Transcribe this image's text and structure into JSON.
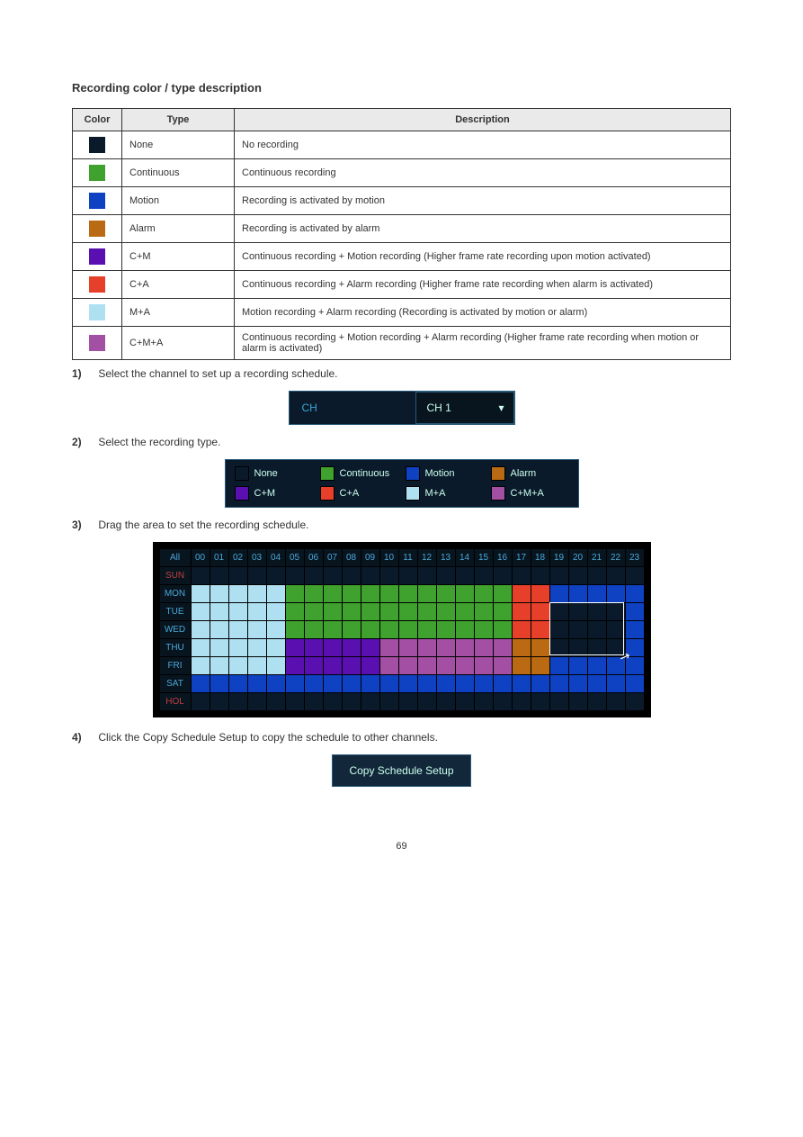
{
  "section_title": "Recording color / type description",
  "table": {
    "headers": [
      "Color",
      "Type",
      "Description"
    ],
    "rows": [
      {
        "color": "#0a1a2a",
        "type": "None",
        "desc": "No recording"
      },
      {
        "color": "#3fa12e",
        "type": "Continuous",
        "desc": "Continuous recording"
      },
      {
        "color": "#0f42c2",
        "type": "Motion",
        "desc": "Recording is activated by motion"
      },
      {
        "color": "#b96a12",
        "type": "Alarm",
        "desc": "Recording is activated by alarm"
      },
      {
        "color": "#5a0fb0",
        "type": "C+M",
        "desc": "Continuous recording + Motion recording\n(Higher frame rate recording upon motion activated)"
      },
      {
        "color": "#e7402a",
        "type": "C+A",
        "desc": "Continuous recording + Alarm recording\n(Higher frame rate recording when alarm is activated)"
      },
      {
        "color": "#aee0f2",
        "type": "M+A",
        "desc": "Motion recording + Alarm recording\n(Recording is activated by motion or alarm)"
      },
      {
        "color": "#a34fa3",
        "type": "C+M+A",
        "desc": "Continuous recording + Motion recording + Alarm recording\n(Higher frame rate recording when motion or alarm is activated)"
      }
    ]
  },
  "steps": {
    "s1": "Select the channel to set up a recording schedule.",
    "s2": "Select the recording type.",
    "s3": "Drag the area to set the recording schedule.",
    "s4": "Click the Copy Schedule Setup to copy the schedule to other channels."
  },
  "step_labels": {
    "s1": "1)",
    "s2": "2)",
    "s3": "3)",
    "s4": "4)"
  },
  "ch_selector": {
    "label": "CH",
    "value": "CH 1"
  },
  "legend": {
    "row1": [
      {
        "label": "None",
        "color": "#0a1a2a"
      },
      {
        "label": "Continuous",
        "color": "#3fa12e"
      },
      {
        "label": "Motion",
        "color": "#0f42c2"
      },
      {
        "label": "Alarm",
        "color": "#b96a12"
      }
    ],
    "row2": [
      {
        "label": "C+M",
        "color": "#5a0fb0"
      },
      {
        "label": "C+A",
        "color": "#e7402a"
      },
      {
        "label": "M+A",
        "color": "#aee0f2"
      },
      {
        "label": "C+M+A",
        "color": "#a34fa3"
      }
    ]
  },
  "grid": {
    "all": "All",
    "hours": [
      "00",
      "01",
      "02",
      "03",
      "04",
      "05",
      "06",
      "07",
      "08",
      "09",
      "10",
      "11",
      "12",
      "13",
      "14",
      "15",
      "16",
      "17",
      "18",
      "19",
      "20",
      "21",
      "22",
      "23"
    ],
    "days": [
      {
        "label": "SUN",
        "red": true
      },
      {
        "label": "MON",
        "red": false
      },
      {
        "label": "TUE",
        "red": false
      },
      {
        "label": "WED",
        "red": false
      },
      {
        "label": "THU",
        "red": false
      },
      {
        "label": "FRI",
        "red": false
      },
      {
        "label": "SAT",
        "red": false
      },
      {
        "label": "HOL",
        "red": true
      }
    ],
    "colors": {
      "none": "#0a1a2a",
      "cont": "#3fa12e",
      "motion": "#0f42c2",
      "alarm": "#b96a12",
      "cm": "#5a0fb0",
      "ca": "#e7402a",
      "ma": "#aee0f2",
      "cma": "#a34fa3"
    },
    "cells": [
      [
        "none",
        "none",
        "none",
        "none",
        "none",
        "none",
        "none",
        "none",
        "none",
        "none",
        "none",
        "none",
        "none",
        "none",
        "none",
        "none",
        "none",
        "none",
        "none",
        "none",
        "none",
        "none",
        "none",
        "none"
      ],
      [
        "ma",
        "ma",
        "ma",
        "ma",
        "ma",
        "cont",
        "cont",
        "cont",
        "cont",
        "cont",
        "cont",
        "cont",
        "cont",
        "cont",
        "cont",
        "cont",
        "cont",
        "ca",
        "ca",
        "motion",
        "motion",
        "motion",
        "motion",
        "motion"
      ],
      [
        "ma",
        "ma",
        "ma",
        "ma",
        "ma",
        "cont",
        "cont",
        "cont",
        "cont",
        "cont",
        "cont",
        "cont",
        "cont",
        "cont",
        "cont",
        "cont",
        "cont",
        "ca",
        "ca",
        "none",
        "none",
        "none",
        "none",
        "motion"
      ],
      [
        "ma",
        "ma",
        "ma",
        "ma",
        "ma",
        "cont",
        "cont",
        "cont",
        "cont",
        "cont",
        "cont",
        "cont",
        "cont",
        "cont",
        "cont",
        "cont",
        "cont",
        "ca",
        "ca",
        "none",
        "none",
        "none",
        "none",
        "motion"
      ],
      [
        "ma",
        "ma",
        "ma",
        "ma",
        "ma",
        "cm",
        "cm",
        "cm",
        "cm",
        "cm",
        "cma",
        "cma",
        "cma",
        "cma",
        "cma",
        "cma",
        "cma",
        "alarm",
        "alarm",
        "none",
        "none",
        "none",
        "none",
        "motion"
      ],
      [
        "ma",
        "ma",
        "ma",
        "ma",
        "ma",
        "cm",
        "cm",
        "cm",
        "cm",
        "cm",
        "cma",
        "cma",
        "cma",
        "cma",
        "cma",
        "cma",
        "cma",
        "alarm",
        "alarm",
        "motion",
        "motion",
        "motion",
        "motion",
        "motion"
      ],
      [
        "motion",
        "motion",
        "motion",
        "motion",
        "motion",
        "motion",
        "motion",
        "motion",
        "motion",
        "motion",
        "motion",
        "motion",
        "motion",
        "motion",
        "motion",
        "motion",
        "motion",
        "motion",
        "motion",
        "motion",
        "motion",
        "motion",
        "motion",
        "motion"
      ],
      [
        "none",
        "none",
        "none",
        "none",
        "none",
        "none",
        "none",
        "none",
        "none",
        "none",
        "none",
        "none",
        "none",
        "none",
        "none",
        "none",
        "none",
        "none",
        "none",
        "none",
        "none",
        "none",
        "none",
        "none"
      ]
    ],
    "selection": {
      "row_start": 2,
      "row_end": 4,
      "col_start": 19,
      "col_end": 22
    }
  },
  "copy_button": "Copy Schedule Setup",
  "page_number": "69"
}
